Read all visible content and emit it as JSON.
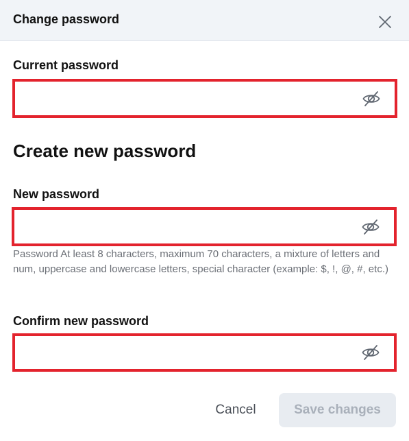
{
  "dialog": {
    "title": "Change password",
    "close_icon": "close-icon"
  },
  "current_password": {
    "label": "Current password",
    "value": "",
    "icon": "eye-off-icon"
  },
  "section": {
    "title": "Create new password"
  },
  "new_password": {
    "label": "New password",
    "value": "",
    "icon": "eye-off-icon",
    "hint": "Password At least 8 characters, maximum 70 characters, a mixture of letters and num, uppercase and lowercase letters, special character (example: $, !, @, #, etc.)"
  },
  "confirm_password": {
    "label": "Confirm new password",
    "value": "",
    "icon": "eye-off-icon"
  },
  "actions": {
    "cancel_label": "Cancel",
    "save_label": "Save changes"
  },
  "colors": {
    "highlight_border": "#e3232d",
    "header_bg": "#f1f4f8",
    "save_disabled_bg": "#e8ecf1",
    "save_disabled_text": "#a9b0ba"
  }
}
